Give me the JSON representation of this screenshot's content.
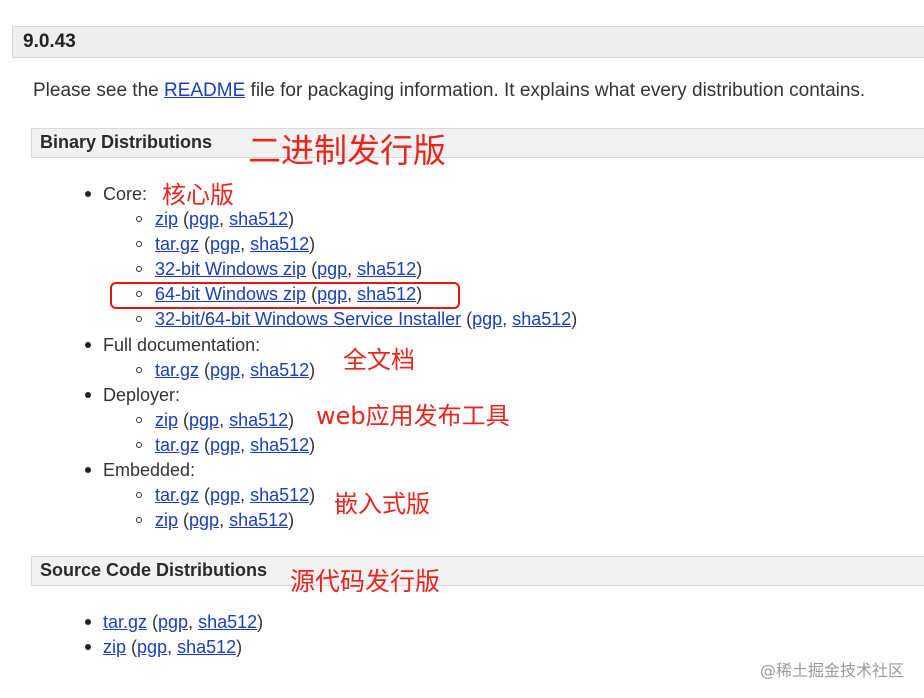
{
  "version": "9.0.43",
  "intro": {
    "before": "Please see the ",
    "link": "README",
    "after": " file for packaging information. It explains what every distribution contains."
  },
  "binary": {
    "title": "Binary Distributions",
    "annotation": "二进制发行版",
    "core": {
      "label": "Core:",
      "annotation": "核心版",
      "items": [
        {
          "name": "zip",
          "pgp": "pgp",
          "sha": "sha512"
        },
        {
          "name": "tar.gz",
          "pgp": "pgp",
          "sha": "sha512"
        },
        {
          "name": "32-bit Windows zip",
          "pgp": "pgp",
          "sha": "sha512"
        },
        {
          "name": "64-bit Windows zip",
          "pgp": "pgp",
          "sha": "sha512"
        },
        {
          "name": "32-bit/64-bit Windows Service Installer",
          "pgp": "pgp",
          "sha": "sha512"
        }
      ]
    },
    "fulldoc": {
      "label": "Full documentation:",
      "annotation": "全文档",
      "items": [
        {
          "name": "tar.gz",
          "pgp": "pgp",
          "sha": "sha512"
        }
      ]
    },
    "deployer": {
      "label": "Deployer:",
      "annotation": "web应用发布工具",
      "items": [
        {
          "name": "zip",
          "pgp": "pgp",
          "sha": "sha512"
        },
        {
          "name": "tar.gz",
          "pgp": "pgp",
          "sha": "sha512"
        }
      ]
    },
    "embedded": {
      "label": "Embedded:",
      "annotation": "嵌入式版",
      "items": [
        {
          "name": "tar.gz",
          "pgp": "pgp",
          "sha": "sha512"
        },
        {
          "name": "zip",
          "pgp": "pgp",
          "sha": "sha512"
        }
      ]
    }
  },
  "source": {
    "title": "Source Code Distributions",
    "annotation": "源代码发行版",
    "items": [
      {
        "name": "tar.gz",
        "pgp": "pgp",
        "sha": "sha512"
      },
      {
        "name": "zip",
        "pgp": "pgp",
        "sha": "sha512"
      }
    ]
  },
  "punct": {
    "open": " (",
    "comma": ", ",
    "close": ")"
  },
  "watermark": "@稀土掘金技术社区",
  "colors": {
    "link": "#1a3fb8",
    "annotation": "#e8261e",
    "highlight": "#e01a12"
  }
}
